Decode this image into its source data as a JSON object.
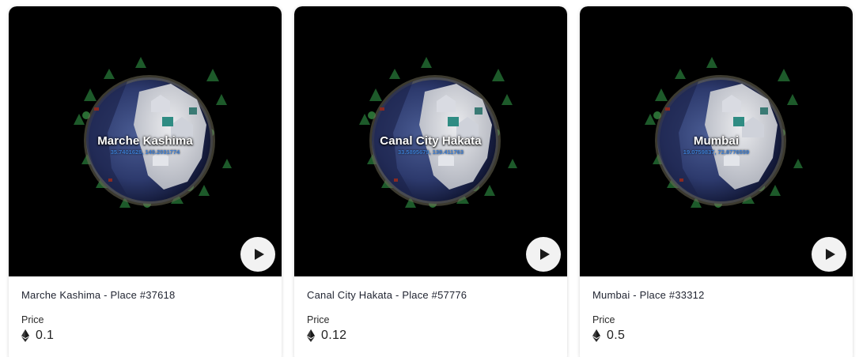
{
  "cards": [
    {
      "overlay_title": "Marche Kashima",
      "overlay_coords": "35.7401628, 140.2031774",
      "name": "Marche Kashima - Place #37618",
      "price_label": "Price",
      "price": "0.1",
      "currency_icon": "ethereum-icon"
    },
    {
      "overlay_title": "Canal City Hakata",
      "overlay_coords": "33.5895679, 130.411763",
      "name": "Canal City Hakata - Place #57776",
      "price_label": "Price",
      "price": "0.12",
      "currency_icon": "ethereum-icon"
    },
    {
      "overlay_title": "Mumbai",
      "overlay_coords": "19.0759837, 72.8776559",
      "name": "Mumbai - Place #33312",
      "price_label": "Price",
      "price": "0.5",
      "currency_icon": "ethereum-icon"
    }
  ],
  "colors": {
    "media_background": "#000000",
    "coords_text": "#3d7fd6",
    "card_background": "#ffffff",
    "play_button": "#f2f2f2"
  }
}
